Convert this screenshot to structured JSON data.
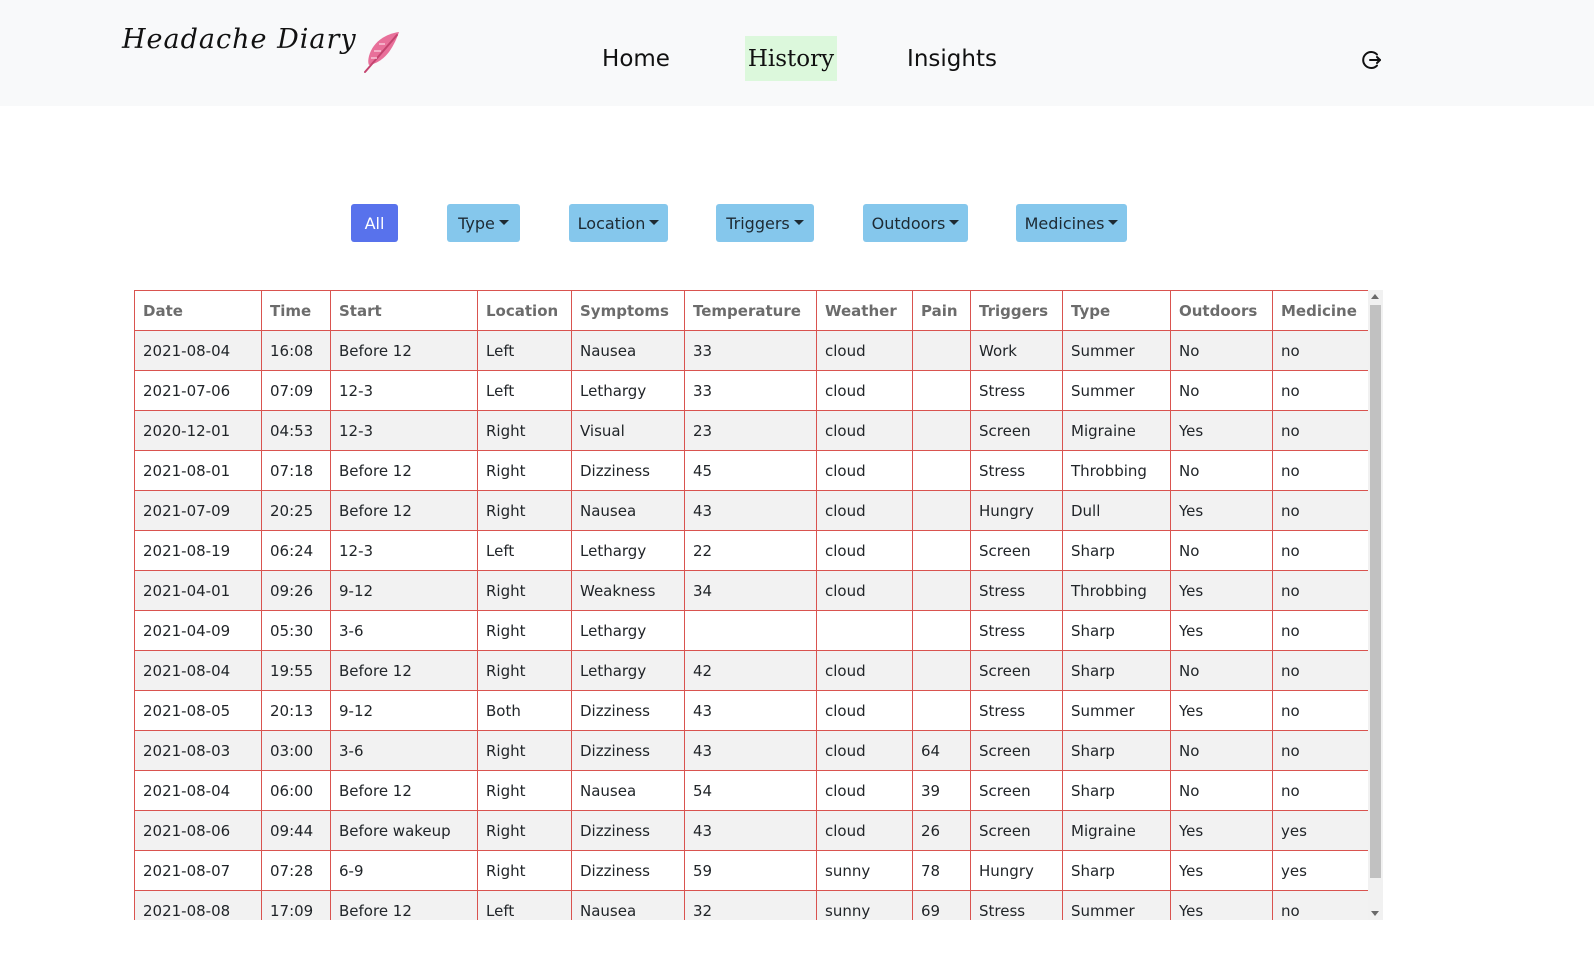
{
  "brand": {
    "title": "Headache Diary"
  },
  "nav": {
    "home": "Home",
    "history": "History",
    "insights": "Insights"
  },
  "filters": {
    "all": "All",
    "type": "Type",
    "location": "Location",
    "triggers": "Triggers",
    "outdoors": "Outdoors",
    "medicines": "Medicines"
  },
  "colors": {
    "nav_bg": "#f8f9fa",
    "active_nav_bg": "#dcf8dc",
    "filter_btn": "#85c7ec",
    "filter_active": "#5872ec",
    "table_border": "#d9534f",
    "feather": "#e8709a"
  },
  "icons": {
    "brand": "feather-icon",
    "logout": "logout-icon",
    "dropdown": "caret-down-icon"
  },
  "table": {
    "columns": [
      "Date",
      "Time",
      "Start",
      "Location",
      "Symptoms",
      "Temperature",
      "Weather",
      "Pain",
      "Triggers",
      "Type",
      "Outdoors",
      "Medicine"
    ],
    "rows": [
      [
        "2021-08-04",
        "16:08",
        "Before 12",
        "Left",
        "Nausea",
        "33",
        "cloud",
        "",
        "Work",
        "Summer",
        "No",
        "no"
      ],
      [
        "2021-07-06",
        "07:09",
        "12-3",
        "Left",
        "Lethargy",
        "33",
        "cloud",
        "",
        "Stress",
        "Summer",
        "No",
        "no"
      ],
      [
        "2020-12-01",
        "04:53",
        "12-3",
        "Right",
        "Visual",
        "23",
        "cloud",
        "",
        "Screen",
        "Migraine",
        "Yes",
        "no"
      ],
      [
        "2021-08-01",
        "07:18",
        "Before 12",
        "Right",
        "Dizziness",
        "45",
        "cloud",
        "",
        "Stress",
        "Throbbing",
        "No",
        "no"
      ],
      [
        "2021-07-09",
        "20:25",
        "Before 12",
        "Right",
        "Nausea",
        "43",
        "cloud",
        "",
        "Hungry",
        "Dull",
        "Yes",
        "no"
      ],
      [
        "2021-08-19",
        "06:24",
        "12-3",
        "Left",
        "Lethargy",
        "22",
        "cloud",
        "",
        "Screen",
        "Sharp",
        "No",
        "no"
      ],
      [
        "2021-04-01",
        "09:26",
        "9-12",
        "Right",
        "Weakness",
        "34",
        "cloud",
        "",
        "Stress",
        "Throbbing",
        "Yes",
        "no"
      ],
      [
        "2021-04-09",
        "05:30",
        "3-6",
        "Right",
        "Lethargy",
        "",
        "",
        "",
        "Stress",
        "Sharp",
        "Yes",
        "no"
      ],
      [
        "2021-08-04",
        "19:55",
        "Before 12",
        "Right",
        "Lethargy",
        "42",
        "cloud",
        "",
        "Screen",
        "Sharp",
        "No",
        "no"
      ],
      [
        "2021-08-05",
        "20:13",
        "9-12",
        "Both",
        "Dizziness",
        "43",
        "cloud",
        "",
        "Stress",
        "Summer",
        "Yes",
        "no"
      ],
      [
        "2021-08-03",
        "03:00",
        "3-6",
        "Right",
        "Dizziness",
        "43",
        "cloud",
        "64",
        "Screen",
        "Sharp",
        "No",
        "no"
      ],
      [
        "2021-08-04",
        "06:00",
        "Before 12",
        "Right",
        "Nausea",
        "54",
        "cloud",
        "39",
        "Screen",
        "Sharp",
        "No",
        "no"
      ],
      [
        "2021-08-06",
        "09:44",
        "Before wakeup",
        "Right",
        "Dizziness",
        "43",
        "cloud",
        "26",
        "Screen",
        "Migraine",
        "Yes",
        "yes"
      ],
      [
        "2021-08-07",
        "07:28",
        "6-9",
        "Right",
        "Dizziness",
        "59",
        "sunny",
        "78",
        "Hungry",
        "Sharp",
        "Yes",
        "yes"
      ],
      [
        "2021-08-08",
        "17:09",
        "Before 12",
        "Left",
        "Nausea",
        "32",
        "sunny",
        "69",
        "Stress",
        "Summer",
        "Yes",
        "no"
      ]
    ]
  }
}
